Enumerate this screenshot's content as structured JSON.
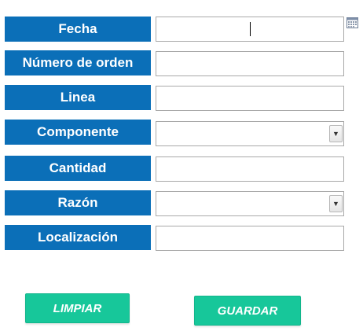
{
  "form": {
    "rows": [
      {
        "label": "Fecha",
        "type": "date",
        "value": ""
      },
      {
        "label": "Número de orden",
        "type": "text",
        "value": ""
      },
      {
        "label": "Linea",
        "type": "text",
        "value": ""
      },
      {
        "label": "Componente",
        "type": "select",
        "value": ""
      },
      {
        "label": "Cantidad",
        "type": "text",
        "value": ""
      },
      {
        "label": "Razón",
        "type": "select",
        "value": ""
      },
      {
        "label": "Localización",
        "type": "text",
        "value": ""
      }
    ]
  },
  "buttons": {
    "clear_label": "LIMPIAR",
    "save_label": "GUARDAR"
  },
  "icons": {
    "calendar": "calendar-icon",
    "dropdown": "chevron-down-icon"
  },
  "colors": {
    "label_bg": "#0b6fb8",
    "label_text": "#ffffff",
    "button_bg": "#17c79a",
    "button_text": "#ffffff",
    "field_border": "#a9a9a9"
  }
}
